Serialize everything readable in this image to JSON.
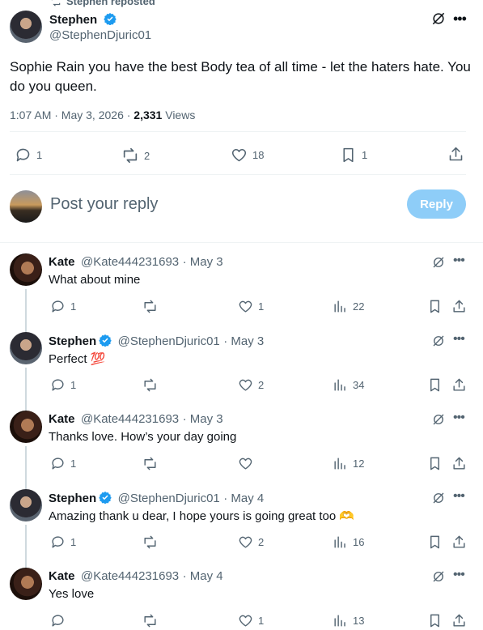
{
  "repost_banner": "Stephen reposted",
  "main_tweet": {
    "name": "Stephen",
    "handle": "@StephenDjuric01",
    "text_line1": "Sophie Rain you have the best Body tea of all time - let the haters hate. You",
    "text_line2": "do you queen.",
    "time": "1:07 AM · May 3, 2026 · ",
    "views_count": "2,331",
    "views_label": " Views",
    "replies": "1",
    "reposts": "2",
    "likes": "18",
    "bookmarks": "1"
  },
  "reply_box": {
    "placeholder": "Post your reply",
    "button": "Reply"
  },
  "replies": [
    {
      "name": "Kate",
      "verified": false,
      "handle": "@Kate444231693",
      "date": "· May 3",
      "text": "What about mine",
      "replies": "1",
      "reposts": "",
      "likes": "1",
      "views": "22",
      "avatar": "kate"
    },
    {
      "name": "Stephen",
      "verified": true,
      "handle": "@StephenDjuric01",
      "date": "· May 3",
      "text": "Perfect 💯",
      "replies": "1",
      "reposts": "",
      "likes": "2",
      "views": "34",
      "avatar": "stephen"
    },
    {
      "name": "Kate",
      "verified": false,
      "handle": "@Kate444231693",
      "date": "· May 3",
      "text": "Thanks love. How’s your day going",
      "replies": "1",
      "reposts": "",
      "likes": "",
      "views": "12",
      "avatar": "kate"
    },
    {
      "name": "Stephen",
      "verified": true,
      "handle": "@StephenDjuric01",
      "date": "· May 4",
      "text": "Amazing thank u dear, I hope yours is going great too 🫶",
      "replies": "1",
      "reposts": "",
      "likes": "2",
      "views": "16",
      "avatar": "stephen"
    },
    {
      "name": "Kate",
      "verified": false,
      "handle": "@Kate444231693",
      "date": "· May 4",
      "text": "Yes love",
      "replies": "",
      "reposts": "",
      "likes": "1",
      "views": "13",
      "avatar": "kate"
    }
  ],
  "colors": {
    "accent": "#1d9bf0",
    "reply_button_bg": "#8ecdf8",
    "text_secondary": "#536471"
  }
}
